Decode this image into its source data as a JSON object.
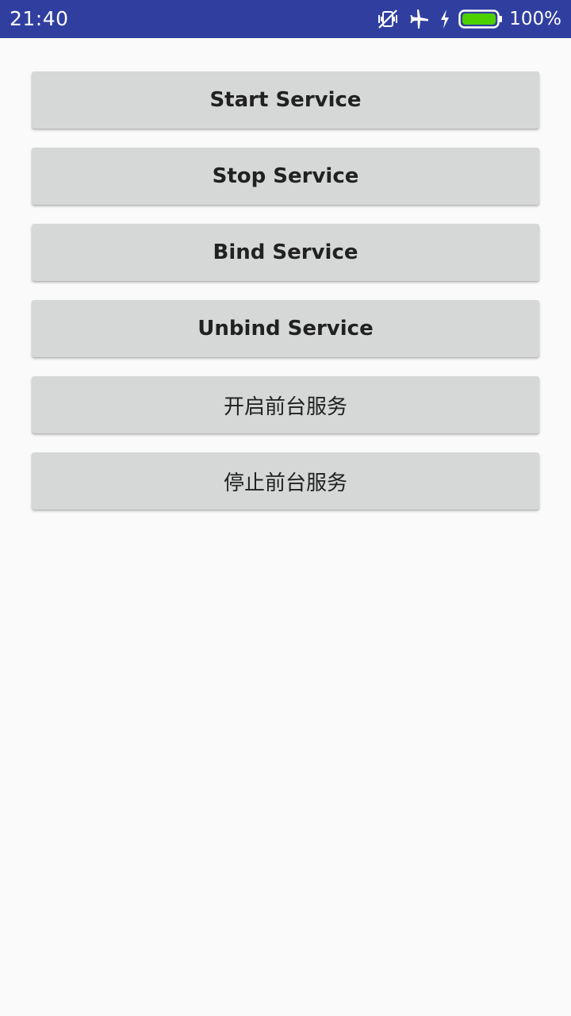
{
  "status_bar": {
    "time": "21:40",
    "battery_percent": "100%",
    "icons": [
      "vibrate-off-icon",
      "airplane-icon",
      "charging-bolt-icon",
      "battery-icon"
    ],
    "battery_level": 1.0,
    "background_color": "#303f9f",
    "battery_fill_color": "#4cd000"
  },
  "buttons": [
    {
      "label": "Start Service"
    },
    {
      "label": "Stop Service"
    },
    {
      "label": "Bind Service"
    },
    {
      "label": "Unbind Service"
    },
    {
      "label": "开启前台服务"
    },
    {
      "label": "停止前台服务"
    }
  ],
  "colors": {
    "page_background": "#fafafa",
    "button_background": "#d6d7d7",
    "button_text": "#212121"
  }
}
